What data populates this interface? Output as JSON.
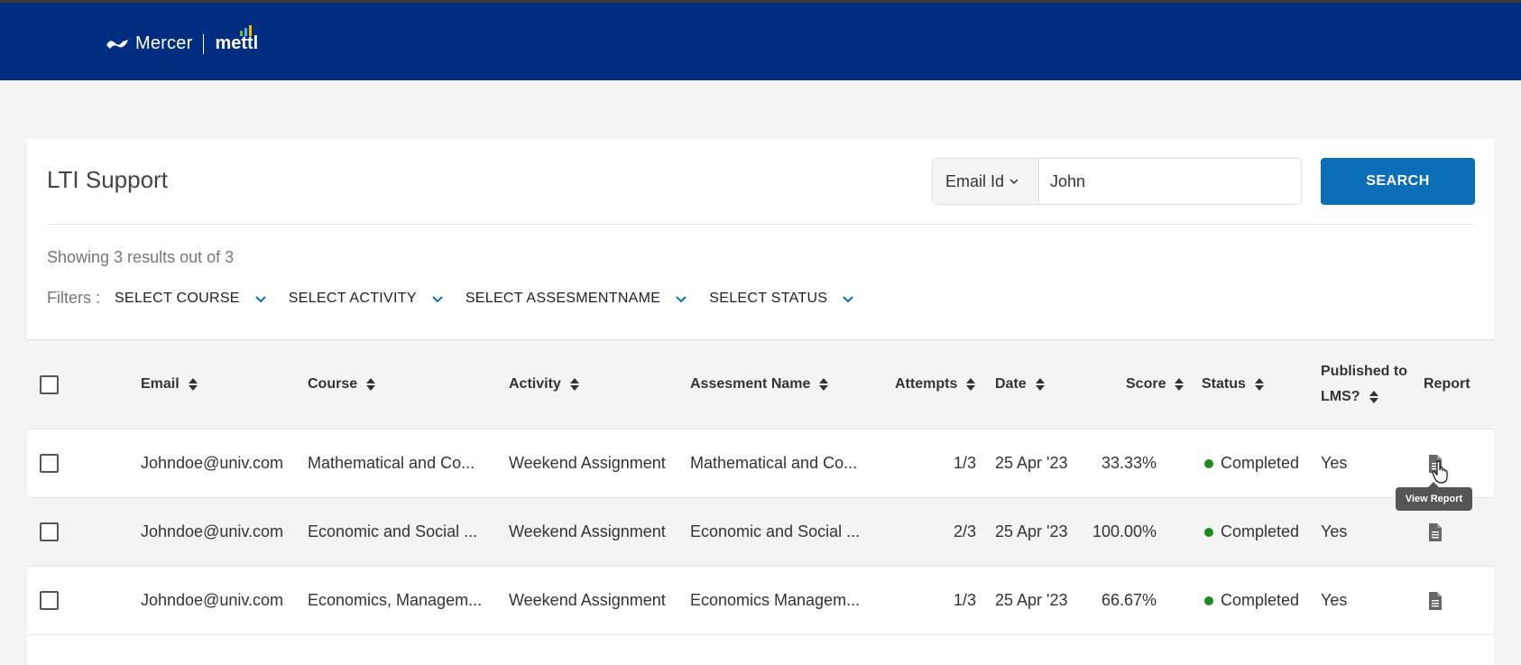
{
  "header": {
    "brand_primary": "Mercer",
    "brand_secondary": "mettl",
    "bg_color": "#002d7f"
  },
  "page": {
    "title": "LTI Support",
    "results_text": "Showing 3 results out of 3"
  },
  "search": {
    "type_label": "Email Id",
    "value": "John",
    "button_label": "SEARCH"
  },
  "filters": {
    "label": "Filters :",
    "items": [
      "SELECT COURSE",
      "SELECT ACTIVITY",
      "SELECT ASSESMENTNAME",
      "SELECT STATUS"
    ]
  },
  "table": {
    "columns": {
      "email": "Email",
      "course": "Course",
      "activity": "Activity",
      "assessment": "Assesment Name",
      "attempts": "Attempts",
      "date": "Date",
      "score": "Score",
      "status": "Status",
      "published_line1": "Published to",
      "published_line2": "LMS?",
      "report": "Report"
    },
    "rows": [
      {
        "email": "Johndoe@univ.com",
        "course": "Mathematical and Co...",
        "activity": "Weekend Assignment",
        "assessment": "Mathematical and Co...",
        "attempts": "1/3",
        "date": "25 Apr '23",
        "score": "33.33%",
        "status": "Completed",
        "published": "Yes"
      },
      {
        "email": "Johndoe@univ.com",
        "course": "Economic and Social ...",
        "activity": "Weekend Assignment",
        "assessment": "Economic and Social ...",
        "attempts": "2/3",
        "date": "25 Apr '23",
        "score": "100.00%",
        "status": "Completed",
        "published": "Yes"
      },
      {
        "email": "Johndoe@univ.com",
        "course": "Economics, Managem...",
        "activity": "Weekend Assignment",
        "assessment": "Economics Managem...",
        "attempts": "1/3",
        "date": "25 Apr '23",
        "score": "66.67%",
        "status": "Completed",
        "published": "Yes"
      }
    ]
  },
  "tooltip": {
    "text": "View Report"
  },
  "colors": {
    "accent": "#0b6fb8",
    "status_completed": "#1e8a1e"
  }
}
